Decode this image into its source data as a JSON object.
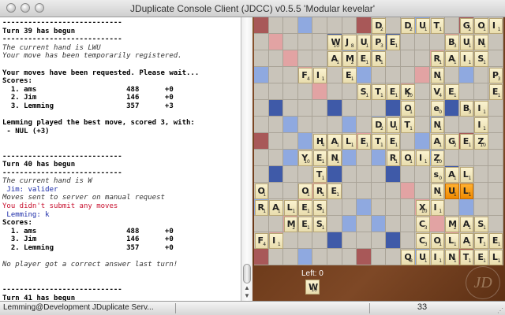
{
  "window": {
    "title": "JDuplicate Console Client (JDCC) v0.5.5 'Modular kevelar'"
  },
  "console": {
    "lines": [
      {
        "text": "----------------------------",
        "style": "b"
      },
      {
        "text": "Turn 39 has begun",
        "style": "b"
      },
      {
        "text": "----------------------------",
        "style": "b"
      },
      {
        "text": "The current hand is LWU",
        "style": "i"
      },
      {
        "text": "Your move has been temporarily registered.",
        "style": "i"
      },
      {
        "text": "",
        "style": "plain"
      },
      {
        "text": "Your moves have been requested. Please wait...",
        "style": "b"
      },
      {
        "text": "Scores:",
        "style": "b"
      },
      {
        "text": "  1. ams                     488      +0",
        "style": "b"
      },
      {
        "text": "  2. Jim                     146      +0",
        "style": "b"
      },
      {
        "text": "  3. Lemming                 357      +3",
        "style": "b"
      },
      {
        "text": "",
        "style": "plain"
      },
      {
        "text": "Lemming played the best move, scored 3, with:",
        "style": "b"
      },
      {
        "text": " - NUL (+3)",
        "style": "b"
      },
      {
        "text": "",
        "style": "plain"
      },
      {
        "text": "",
        "style": "plain"
      },
      {
        "text": "----------------------------",
        "style": "b"
      },
      {
        "text": "Turn 40 has begun",
        "style": "b"
      },
      {
        "text": "----------------------------",
        "style": "b"
      },
      {
        "text": "The current hand is W",
        "style": "i"
      },
      {
        "text": " Jim: valider",
        "style": "blue"
      },
      {
        "text": "Moves sent to server on manual request",
        "style": "i"
      },
      {
        "text": "You didn't submit any moves",
        "style": "red"
      },
      {
        "text": " Lemming: k",
        "style": "blue"
      },
      {
        "text": "Scores:",
        "style": "b"
      },
      {
        "text": "  1. ams                     488      +0",
        "style": "b"
      },
      {
        "text": "  3. Jim                     146      +0",
        "style": "b"
      },
      {
        "text": "  2. Lemming                 357      +0",
        "style": "b"
      },
      {
        "text": "",
        "style": "plain"
      },
      {
        "text": "No player got a correct answer last turn!",
        "style": "i"
      },
      {
        "text": "",
        "style": "plain"
      },
      {
        "text": "",
        "style": "plain"
      },
      {
        "text": "----------------------------",
        "style": "b"
      },
      {
        "text": "Turn 41 has begun",
        "style": "b"
      },
      {
        "text": "----------------------------",
        "style": "b"
      },
      {
        "text": "The current hand is W",
        "style": "i"
      }
    ]
  },
  "board": {
    "cell_colors": {
      "normal": "#c9c4ba",
      "double_letter": "#8fa9e0",
      "triple_letter": "#3f5aa8",
      "double_word": "#e2a3a3",
      "triple_word": "#a85858",
      "highlight": "#f39c1a"
    },
    "specials": [
      {
        "r": 0,
        "c": 0,
        "t": "triple_word"
      },
      {
        "r": 0,
        "c": 3,
        "t": "double_letter"
      },
      {
        "r": 0,
        "c": 7,
        "t": "triple_word"
      },
      {
        "r": 0,
        "c": 11,
        "t": "double_letter"
      },
      {
        "r": 0,
        "c": 14,
        "t": "triple_word"
      },
      {
        "r": 1,
        "c": 1,
        "t": "double_word"
      },
      {
        "r": 1,
        "c": 5,
        "t": "triple_letter"
      },
      {
        "r": 1,
        "c": 9,
        "t": "triple_letter"
      },
      {
        "r": 1,
        "c": 13,
        "t": "double_word"
      },
      {
        "r": 2,
        "c": 2,
        "t": "double_word"
      },
      {
        "r": 2,
        "c": 6,
        "t": "double_letter"
      },
      {
        "r": 2,
        "c": 8,
        "t": "double_letter"
      },
      {
        "r": 2,
        "c": 12,
        "t": "double_word"
      },
      {
        "r": 3,
        "c": 0,
        "t": "double_letter"
      },
      {
        "r": 3,
        "c": 3,
        "t": "double_word"
      },
      {
        "r": 3,
        "c": 7,
        "t": "double_letter"
      },
      {
        "r": 3,
        "c": 11,
        "t": "double_word"
      },
      {
        "r": 3,
        "c": 14,
        "t": "double_letter"
      },
      {
        "r": 4,
        "c": 4,
        "t": "double_word"
      },
      {
        "r": 4,
        "c": 10,
        "t": "double_word"
      },
      {
        "r": 5,
        "c": 1,
        "t": "triple_letter"
      },
      {
        "r": 5,
        "c": 5,
        "t": "triple_letter"
      },
      {
        "r": 5,
        "c": 9,
        "t": "triple_letter"
      },
      {
        "r": 5,
        "c": 13,
        "t": "triple_letter"
      },
      {
        "r": 6,
        "c": 2,
        "t": "double_letter"
      },
      {
        "r": 6,
        "c": 6,
        "t": "double_letter"
      },
      {
        "r": 6,
        "c": 8,
        "t": "double_letter"
      },
      {
        "r": 6,
        "c": 12,
        "t": "double_letter"
      },
      {
        "r": 7,
        "c": 0,
        "t": "triple_word"
      },
      {
        "r": 7,
        "c": 3,
        "t": "double_letter"
      },
      {
        "r": 7,
        "c": 7,
        "t": "double_word"
      },
      {
        "r": 7,
        "c": 11,
        "t": "double_letter"
      },
      {
        "r": 7,
        "c": 14,
        "t": "triple_word"
      },
      {
        "r": 8,
        "c": 2,
        "t": "double_letter"
      },
      {
        "r": 8,
        "c": 6,
        "t": "double_letter"
      },
      {
        "r": 8,
        "c": 8,
        "t": "double_letter"
      },
      {
        "r": 8,
        "c": 12,
        "t": "double_letter"
      },
      {
        "r": 9,
        "c": 1,
        "t": "triple_letter"
      },
      {
        "r": 9,
        "c": 5,
        "t": "triple_letter"
      },
      {
        "r": 9,
        "c": 9,
        "t": "triple_letter"
      },
      {
        "r": 9,
        "c": 13,
        "t": "triple_letter"
      },
      {
        "r": 10,
        "c": 4,
        "t": "double_word"
      },
      {
        "r": 10,
        "c": 10,
        "t": "double_word"
      },
      {
        "r": 11,
        "c": 0,
        "t": "double_letter"
      },
      {
        "r": 11,
        "c": 3,
        "t": "double_word"
      },
      {
        "r": 11,
        "c": 7,
        "t": "double_letter"
      },
      {
        "r": 11,
        "c": 11,
        "t": "double_word"
      },
      {
        "r": 11,
        "c": 14,
        "t": "double_letter"
      },
      {
        "r": 12,
        "c": 2,
        "t": "double_word"
      },
      {
        "r": 12,
        "c": 6,
        "t": "double_letter"
      },
      {
        "r": 12,
        "c": 8,
        "t": "double_letter"
      },
      {
        "r": 12,
        "c": 12,
        "t": "double_word"
      },
      {
        "r": 13,
        "c": 1,
        "t": "double_word"
      },
      {
        "r": 13,
        "c": 5,
        "t": "triple_letter"
      },
      {
        "r": 13,
        "c": 9,
        "t": "triple_letter"
      },
      {
        "r": 13,
        "c": 13,
        "t": "double_word"
      },
      {
        "r": 14,
        "c": 0,
        "t": "triple_word"
      },
      {
        "r": 14,
        "c": 3,
        "t": "double_letter"
      },
      {
        "r": 14,
        "c": 7,
        "t": "triple_word"
      },
      {
        "r": 14,
        "c": 11,
        "t": "double_letter"
      },
      {
        "r": 14,
        "c": 14,
        "t": "triple_word"
      }
    ],
    "tiles": [
      {
        "r": 0,
        "c": 8,
        "l": "D",
        "s": "2"
      },
      {
        "r": 0,
        "c": 10,
        "l": "D",
        "s": "2"
      },
      {
        "r": 0,
        "c": 11,
        "l": "U",
        "s": "1"
      },
      {
        "r": 0,
        "c": 12,
        "l": "T",
        "s": "1"
      },
      {
        "r": 0,
        "c": 14,
        "l": "G",
        "s": "2"
      },
      {
        "r": 0,
        "c": 15,
        "l": "O",
        "s": "1"
      },
      {
        "r": 0,
        "c": 16,
        "l": "I",
        "s": "1"
      },
      {
        "r": 1,
        "c": 5,
        "l": "W",
        "s": "10"
      },
      {
        "r": 1,
        "c": 6,
        "l": "J",
        "s": "8"
      },
      {
        "r": 1,
        "c": 7,
        "l": "U",
        "s": "1"
      },
      {
        "r": 1,
        "c": 8,
        "l": "P",
        "s": "3"
      },
      {
        "r": 1,
        "c": 9,
        "l": "E",
        "s": "1"
      },
      {
        "r": 1,
        "c": 13,
        "l": "B",
        "s": "3"
      },
      {
        "r": 1,
        "c": 14,
        "l": "U",
        "s": "1"
      },
      {
        "r": 1,
        "c": 15,
        "l": "N",
        "s": "1"
      },
      {
        "r": 2,
        "c": 5,
        "l": "A",
        "s": "1"
      },
      {
        "r": 2,
        "c": 6,
        "l": "M",
        "s": "2"
      },
      {
        "r": 2,
        "c": 7,
        "l": "E",
        "s": "1"
      },
      {
        "r": 2,
        "c": 8,
        "l": "R",
        "s": "1"
      },
      {
        "r": 2,
        "c": 12,
        "l": "R",
        "s": "1"
      },
      {
        "r": 2,
        "c": 13,
        "l": "A",
        "s": "1"
      },
      {
        "r": 2,
        "c": 14,
        "l": "I",
        "s": "1"
      },
      {
        "r": 2,
        "c": 15,
        "l": "S",
        "s": "1"
      },
      {
        "r": 3,
        "c": 3,
        "l": "F",
        "s": "4"
      },
      {
        "r": 3,
        "c": 4,
        "l": "I",
        "s": "1"
      },
      {
        "r": 3,
        "c": 6,
        "l": "E",
        "s": "1"
      },
      {
        "r": 3,
        "c": 12,
        "l": "N",
        "s": "1"
      },
      {
        "r": 3,
        "c": 16,
        "l": "P",
        "s": "3"
      },
      {
        "r": 4,
        "c": 7,
        "l": "S",
        "s": "1"
      },
      {
        "r": 4,
        "c": 8,
        "l": "T",
        "s": "1"
      },
      {
        "r": 4,
        "c": 9,
        "l": "E",
        "s": "1"
      },
      {
        "r": 4,
        "c": 10,
        "l": "K",
        "s": "10"
      },
      {
        "r": 4,
        "c": 12,
        "l": "V",
        "s": "4"
      },
      {
        "r": 4,
        "c": 13,
        "l": "E",
        "s": "1"
      },
      {
        "r": 4,
        "c": 16,
        "l": "E",
        "s": "1"
      },
      {
        "r": 5,
        "c": 10,
        "l": "O",
        "s": "1"
      },
      {
        "r": 5,
        "c": 12,
        "l": "e",
        "s": "0"
      },
      {
        "r": 5,
        "c": 14,
        "l": "B",
        "s": "3"
      },
      {
        "r": 5,
        "c": 15,
        "l": "I",
        "s": "1"
      },
      {
        "r": 6,
        "c": 8,
        "l": "D",
        "s": "2"
      },
      {
        "r": 6,
        "c": 9,
        "l": "U",
        "s": "1"
      },
      {
        "r": 6,
        "c": 10,
        "l": "T",
        "s": "1"
      },
      {
        "r": 6,
        "c": 12,
        "l": "N",
        "s": "1"
      },
      {
        "r": 6,
        "c": 15,
        "l": "I",
        "s": "1"
      },
      {
        "r": 7,
        "c": 4,
        "l": "H",
        "s": "4"
      },
      {
        "r": 7,
        "c": 5,
        "l": "A",
        "s": "1"
      },
      {
        "r": 7,
        "c": 6,
        "l": "L",
        "s": "1"
      },
      {
        "r": 7,
        "c": 7,
        "l": "E",
        "s": "1"
      },
      {
        "r": 7,
        "c": 8,
        "l": "T",
        "s": "1"
      },
      {
        "r": 7,
        "c": 9,
        "l": "E",
        "s": "1"
      },
      {
        "r": 7,
        "c": 12,
        "l": "A",
        "s": "1"
      },
      {
        "r": 7,
        "c": 13,
        "l": "G",
        "s": "2"
      },
      {
        "r": 7,
        "c": 14,
        "l": "E",
        "s": "1"
      },
      {
        "r": 7,
        "c": 15,
        "l": "Z",
        "s": "10"
      },
      {
        "r": 8,
        "c": 3,
        "l": "Y",
        "s": "10"
      },
      {
        "r": 8,
        "c": 4,
        "l": "E",
        "s": "1"
      },
      {
        "r": 8,
        "c": 5,
        "l": "N",
        "s": "1"
      },
      {
        "r": 8,
        "c": 9,
        "l": "R",
        "s": "1"
      },
      {
        "r": 8,
        "c": 10,
        "l": "O",
        "s": "1"
      },
      {
        "r": 8,
        "c": 11,
        "l": "I",
        "s": "1"
      },
      {
        "r": 8,
        "c": 12,
        "l": "Z",
        "s": "10"
      },
      {
        "r": 9,
        "c": 4,
        "l": "T",
        "s": "1"
      },
      {
        "r": 9,
        "c": 12,
        "l": "s",
        "s": "0"
      },
      {
        "r": 9,
        "c": 13,
        "l": "A",
        "s": "1"
      },
      {
        "r": 9,
        "c": 14,
        "l": "L",
        "s": "1"
      },
      {
        "r": 10,
        "c": 0,
        "l": "O",
        "s": "1"
      },
      {
        "r": 10,
        "c": 3,
        "l": "O",
        "s": "1"
      },
      {
        "r": 10,
        "c": 4,
        "l": "R",
        "s": "1"
      },
      {
        "r": 10,
        "c": 5,
        "l": "E",
        "s": "1"
      },
      {
        "r": 10,
        "c": 12,
        "l": "N",
        "s": "1"
      },
      {
        "r": 10,
        "c": 13,
        "l": "U",
        "s": "1",
        "hl": true
      },
      {
        "r": 10,
        "c": 14,
        "l": "L",
        "s": "1",
        "hl": true
      },
      {
        "r": 11,
        "c": 0,
        "l": "R",
        "s": "1"
      },
      {
        "r": 11,
        "c": 1,
        "l": "A",
        "s": "1"
      },
      {
        "r": 11,
        "c": 2,
        "l": "L",
        "s": "1"
      },
      {
        "r": 11,
        "c": 3,
        "l": "E",
        "s": "1"
      },
      {
        "r": 11,
        "c": 4,
        "l": "S",
        "s": "1"
      },
      {
        "r": 11,
        "c": 11,
        "l": "X",
        "s": "10"
      },
      {
        "r": 11,
        "c": 12,
        "l": "I",
        "s": "1"
      },
      {
        "r": 12,
        "c": 2,
        "l": "M",
        "s": "2"
      },
      {
        "r": 12,
        "c": 3,
        "l": "E",
        "s": "1"
      },
      {
        "r": 12,
        "c": 4,
        "l": "S",
        "s": "1"
      },
      {
        "r": 12,
        "c": 11,
        "l": "C",
        "s": "3"
      },
      {
        "r": 12,
        "c": 13,
        "l": "M",
        "s": "2"
      },
      {
        "r": 12,
        "c": 14,
        "l": "A",
        "s": "1"
      },
      {
        "r": 12,
        "c": 15,
        "l": "S",
        "s": "1"
      },
      {
        "r": 13,
        "c": 0,
        "l": "F",
        "s": "4"
      },
      {
        "r": 13,
        "c": 1,
        "l": "I",
        "s": "1"
      },
      {
        "r": 13,
        "c": 11,
        "l": "C",
        "s": "3"
      },
      {
        "r": 13,
        "c": 12,
        "l": "O",
        "s": "1"
      },
      {
        "r": 13,
        "c": 13,
        "l": "L",
        "s": "1"
      },
      {
        "r": 13,
        "c": 14,
        "l": "A",
        "s": "1"
      },
      {
        "r": 13,
        "c": 15,
        "l": "T",
        "s": "1"
      },
      {
        "r": 13,
        "c": 16,
        "l": "E",
        "s": "1"
      },
      {
        "r": 14,
        "c": 10,
        "l": "Q",
        "s": "8"
      },
      {
        "r": 14,
        "c": 11,
        "l": "U",
        "s": "1"
      },
      {
        "r": 14,
        "c": 12,
        "l": "I",
        "s": "1"
      },
      {
        "r": 14,
        "c": 13,
        "l": "N",
        "s": "1"
      },
      {
        "r": 14,
        "c": 14,
        "l": "T",
        "s": "1"
      },
      {
        "r": 14,
        "c": 15,
        "l": "E",
        "s": "1"
      },
      {
        "r": 14,
        "c": 16,
        "l": "L",
        "s": "1"
      }
    ]
  },
  "tray": {
    "left_label": "Left: 0",
    "rack": [
      {
        "l": "W",
        "s": "10"
      }
    ]
  },
  "logo": {
    "text": "JD"
  },
  "status": {
    "left": "Lemming@Development JDuplicate Serv...",
    "count": "33"
  }
}
